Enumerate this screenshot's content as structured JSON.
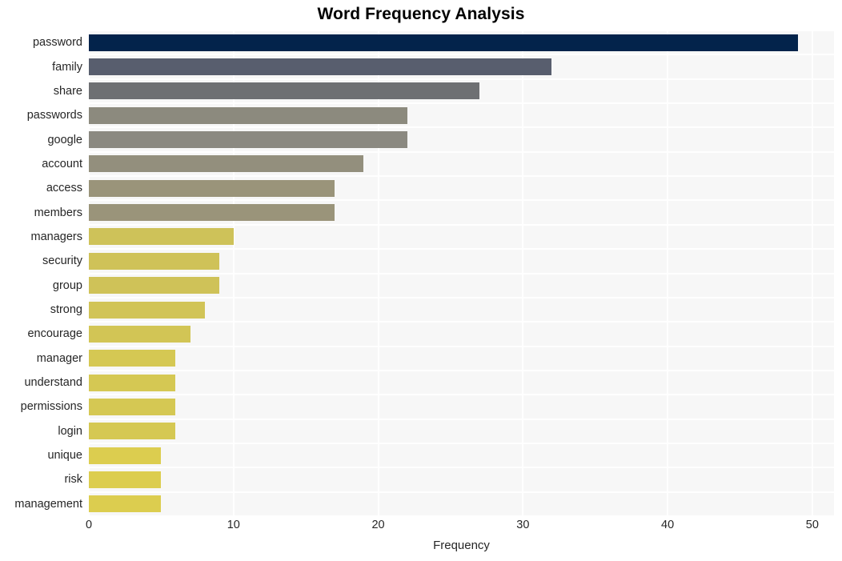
{
  "chart_data": {
    "type": "bar",
    "orientation": "horizontal",
    "title": "Word Frequency Analysis",
    "xlabel": "Frequency",
    "ylabel": "",
    "xlim": [
      0,
      51.5
    ],
    "xticks": [
      0,
      10,
      20,
      30,
      40,
      50
    ],
    "xtick_labels": [
      "0",
      "10",
      "20",
      "30",
      "40",
      "50"
    ],
    "grid": true,
    "grid_color": "#ffffff",
    "plot_background": "#f7f7f7",
    "legend": null,
    "categories": [
      "password",
      "family",
      "share",
      "passwords",
      "google",
      "account",
      "access",
      "members",
      "managers",
      "security",
      "group",
      "strong",
      "encourage",
      "manager",
      "understand",
      "permissions",
      "login",
      "unique",
      "risk",
      "management"
    ],
    "values": [
      49,
      32,
      27,
      22,
      22,
      19,
      17,
      17,
      10,
      9,
      9,
      8,
      7,
      6,
      6,
      6,
      6,
      5,
      5,
      5
    ],
    "bar_colors": [
      "#03234b",
      "#585e6e",
      "#6e7073",
      "#8c8a7e",
      "#8b8981",
      "#938f7d",
      "#9a947a",
      "#9a947a",
      "#cec259",
      "#cfc258",
      "#cfc258",
      "#d1c457",
      "#d2c555",
      "#d5c853",
      "#d5c853",
      "#d5c853",
      "#d5c853",
      "#dccd4f",
      "#dccd4f",
      "#dccd4f"
    ]
  }
}
